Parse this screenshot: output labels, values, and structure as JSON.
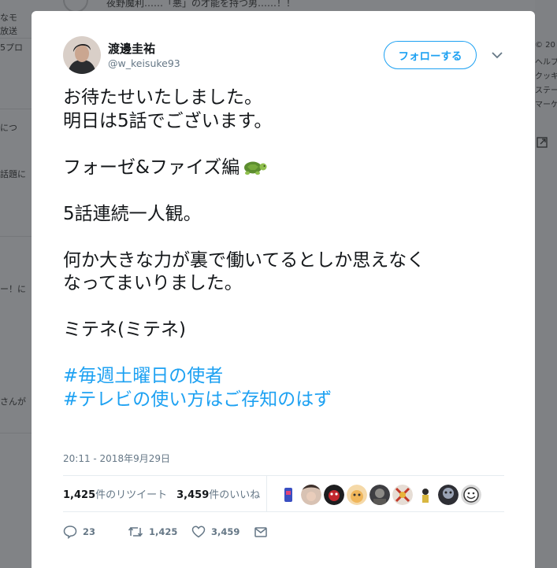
{
  "background": {
    "top_text": "夜野魔利……「悪」の才能を持つ男……！！",
    "left_fragments": [
      "なモ",
      "放送",
      "5プロ",
      "につ",
      "話題に",
      "ー！に",
      "さんが"
    ],
    "right_fragments": [
      "© 20",
      "ヘルプ",
      "クッキ",
      "ステー",
      "マーケ"
    ]
  },
  "tweet": {
    "display_name": "渡邊圭祐",
    "handle": "@w_keisuke93",
    "follow_label": "フォローする",
    "lines": [
      "お待たせいたしました。",
      "明日は5話でございます。",
      "フォーゼ&ファイズ編",
      "5話連続一人観。",
      "何か大きな力が裏で働いてるとしか思えなく",
      "なってまいりました。",
      "ミテネ(ミテネ)"
    ],
    "emoji_icon": "turtle",
    "hashtags": [
      "#毎週土曜日の使者",
      "#テレビの使い方はご存知のはず"
    ],
    "timestamp": "20:11 - 2018年9月29日"
  },
  "stats": {
    "retweets_count": "1,425",
    "retweets_label": "件のリツイート",
    "likes_count": "3,459",
    "likes_label": "件のいいね"
  },
  "actions": {
    "reply_count": "23",
    "retweet_count": "1,425",
    "like_count": "3,459"
  },
  "colors": {
    "accent": "#1da1f2",
    "text_primary": "#14171a",
    "text_secondary": "#657786",
    "overlay": "#7d7f82"
  }
}
